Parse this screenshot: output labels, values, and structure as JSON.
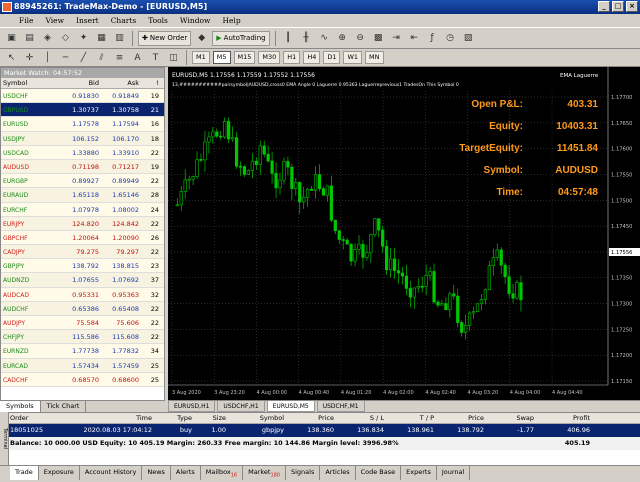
{
  "window": {
    "title": "88945261: TradeMax-Demo - [EURUSD,M5]"
  },
  "menu": [
    "File",
    "View",
    "Insert",
    "Charts",
    "Tools",
    "Window",
    "Help"
  ],
  "toolbar": {
    "new_order": "New Order",
    "autotrading": "AutoTrading"
  },
  "timeframes": [
    "M1",
    "M5",
    "M15",
    "M30",
    "H1",
    "H4",
    "D1",
    "W1",
    "MN"
  ],
  "active_timeframe": "M5",
  "market_watch": {
    "title": "Market Watch: 04:57:52",
    "headers": [
      "Symbol",
      "Bid",
      "Ask",
      "!"
    ],
    "rows": [
      {
        "symbol": "USDCHF",
        "bid": "0.91830",
        "ask": "0.91849",
        "spread": "19",
        "dir": "up"
      },
      {
        "symbol": "GBPUSD",
        "bid": "1.30737",
        "ask": "1.30758",
        "spread": "21",
        "dir": "up",
        "selected": true
      },
      {
        "symbol": "EURUSD",
        "bid": "1.17578",
        "ask": "1.17594",
        "spread": "16",
        "dir": "up"
      },
      {
        "symbol": "USDJPY",
        "bid": "106.152",
        "ask": "106.170",
        "spread": "18",
        "dir": "up"
      },
      {
        "symbol": "USDCAD",
        "bid": "1.33880",
        "ask": "1.33910",
        "spread": "22",
        "dir": "up"
      },
      {
        "symbol": "AUDUSD",
        "bid": "0.71198",
        "ask": "0.71217",
        "spread": "19",
        "dir": "down"
      },
      {
        "symbol": "EURGBP",
        "bid": "0.89927",
        "ask": "0.89949",
        "spread": "22",
        "dir": "up"
      },
      {
        "symbol": "EURAUD",
        "bid": "1.65118",
        "ask": "1.65146",
        "spread": "28",
        "dir": "up"
      },
      {
        "symbol": "EURCHF",
        "bid": "1.07978",
        "ask": "1.08002",
        "spread": "24",
        "dir": "up"
      },
      {
        "symbol": "EURJPY",
        "bid": "124.820",
        "ask": "124.842",
        "spread": "22",
        "dir": "down"
      },
      {
        "symbol": "GBPCHF",
        "bid": "1.20064",
        "ask": "1.20090",
        "spread": "26",
        "dir": "down"
      },
      {
        "symbol": "CADJPY",
        "bid": "79.275",
        "ask": "79.297",
        "spread": "22",
        "dir": "down"
      },
      {
        "symbol": "GBPJPY",
        "bid": "138.792",
        "ask": "138.815",
        "spread": "23",
        "dir": "up"
      },
      {
        "symbol": "AUDNZD",
        "bid": "1.07655",
        "ask": "1.07692",
        "spread": "37",
        "dir": "up"
      },
      {
        "symbol": "AUDCAD",
        "bid": "0.95331",
        "ask": "0.95363",
        "spread": "32",
        "dir": "down"
      },
      {
        "symbol": "AUDCHF",
        "bid": "0.65386",
        "ask": "0.65408",
        "spread": "22",
        "dir": "up"
      },
      {
        "symbol": "AUDJPY",
        "bid": "75.584",
        "ask": "75.606",
        "spread": "22",
        "dir": "down"
      },
      {
        "symbol": "CHFJPY",
        "bid": "115.586",
        "ask": "115.608",
        "spread": "22",
        "dir": "up"
      },
      {
        "symbol": "EURNZD",
        "bid": "1.77738",
        "ask": "1.77832",
        "spread": "34",
        "dir": "up"
      },
      {
        "symbol": "EURCAD",
        "bid": "1.57434",
        "ask": "1.57459",
        "spread": "25",
        "dir": "up"
      },
      {
        "symbol": "CADCHF",
        "bid": "0.68570",
        "ask": "0.68600",
        "spread": "25",
        "dir": "down"
      }
    ],
    "tabs": [
      "Symbols",
      "Tick Chart"
    ]
  },
  "chart": {
    "header": "EURUSD,M5  1.17556 1.17559 1.17552 1.17556",
    "subheader": "13,###########pairsymbol|AUDUSD,cross0 EMA Angle 0 Laguerre 0.95363 Laguerreprevious1 TradesOn This Symbol 0",
    "indicator": "EMA Laguerre",
    "overlay": [
      {
        "label": "Open P&L:",
        "value": "403.31"
      },
      {
        "label": "Equity:",
        "value": "10403.31"
      },
      {
        "label": "TargetEquity:",
        "value": "11451.84"
      },
      {
        "label": "Symbol:",
        "value": "AUDUSD"
      },
      {
        "label": "Time:",
        "value": "04:57:48"
      }
    ],
    "price_labels": [
      "1.17700",
      "1.17650",
      "1.17600",
      "1.17550",
      "1.17500",
      "1.17450",
      "1.17400",
      "1.17350",
      "1.17300",
      "1.17250",
      "1.17200",
      "1.17150"
    ],
    "time_labels": [
      "3 Aug 2020",
      "3 Aug 23:20",
      "4 Aug 00:00",
      "4 Aug 00:40",
      "4 Aug 01:20",
      "4 Aug 02:00",
      "4 Aug 02:40",
      "4 Aug 03:20",
      "4 Aug 04:00",
      "4 Aug 04:40"
    ],
    "current_price": "1.17556",
    "colors": {
      "candle": "#00c800",
      "text": "#ff9a1a",
      "grid": "#505050",
      "axis": "#c0c0c0"
    }
  },
  "chart_tabs": [
    "EURUSD,H1",
    "USDCHF,H1",
    "EURUSD,M5",
    "USDCHF,M1"
  ],
  "active_chart_tab": "EURUSD,M5",
  "terminal": {
    "headers": [
      "Order",
      "Time",
      "Type",
      "Size",
      "Symbol",
      "Price",
      "S / L",
      "T / P",
      "Price",
      "Swap",
      "Profit"
    ],
    "order": [
      "18051025",
      "2020.08.03 17:04:12",
      "buy",
      "1.00",
      "gbpjpy",
      "138.360",
      "136.834",
      "138.961",
      "138.792",
      "-1.77",
      "406.96"
    ],
    "balance_text": "Balance: 10 000.00 USD  Equity: 10 405.19  Margin: 260.33  Free margin: 10 144.86  Margin level: 3996.98%",
    "balance_profit": "405.19",
    "tabs": [
      {
        "label": "Trade"
      },
      {
        "label": "Exposure"
      },
      {
        "label": "Account History"
      },
      {
        "label": "News"
      },
      {
        "label": "Alerts"
      },
      {
        "label": "Mailbox",
        "badge": "16"
      },
      {
        "label": "Market",
        "badge": "180"
      },
      {
        "label": "Signals"
      },
      {
        "label": "Articles"
      },
      {
        "label": "Code Base"
      },
      {
        "label": "Experts"
      },
      {
        "label": "Journal"
      }
    ],
    "side_label": "Terminal"
  }
}
